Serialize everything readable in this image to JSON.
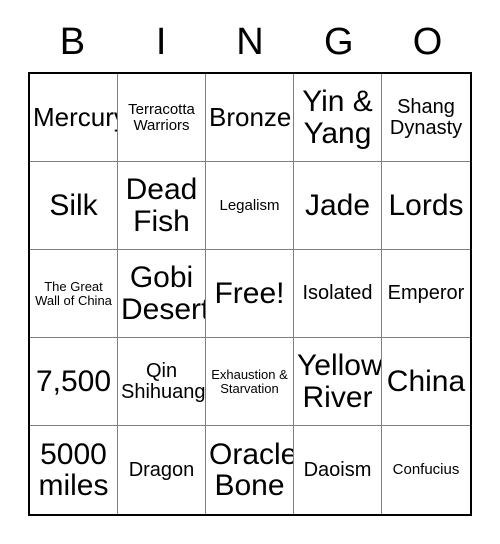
{
  "card": {
    "title_letters": [
      "B",
      "I",
      "N",
      "G",
      "O"
    ],
    "grid": {
      "rows": 5,
      "columns": 5,
      "outer_border_color": "#000000",
      "inner_border_color": "#808080",
      "background_color": "#ffffff",
      "text_color": "#000000"
    },
    "cells": [
      {
        "text": "Mercury",
        "size": "lg"
      },
      {
        "text": "Terracotta Warriors",
        "size": "sm"
      },
      {
        "text": "Bronze",
        "size": "lg"
      },
      {
        "text": "Yin & Yang",
        "size": "xl"
      },
      {
        "text": "Shang Dynasty",
        "size": "md"
      },
      {
        "text": "Silk",
        "size": "xl"
      },
      {
        "text": "Dead Fish",
        "size": "xl"
      },
      {
        "text": "Legalism",
        "size": "sm"
      },
      {
        "text": "Jade",
        "size": "xl"
      },
      {
        "text": "Lords",
        "size": "xl"
      },
      {
        "text": "The Great Wall of China",
        "size": "xs"
      },
      {
        "text": "Gobi Desert",
        "size": "xl"
      },
      {
        "text": "Free!",
        "size": "xl"
      },
      {
        "text": "Isolated",
        "size": "md"
      },
      {
        "text": "Emperor",
        "size": "md"
      },
      {
        "text": "7,500",
        "size": "xl"
      },
      {
        "text": "Qin Shihuang",
        "size": "md"
      },
      {
        "text": "Exhaustion & Starvation",
        "size": "xs"
      },
      {
        "text": "Yellow River",
        "size": "xl"
      },
      {
        "text": "China",
        "size": "xl"
      },
      {
        "text": "5000 miles",
        "size": "xl"
      },
      {
        "text": "Dragon",
        "size": "md"
      },
      {
        "text": "Oracle Bone",
        "size": "xl"
      },
      {
        "text": "Daoism",
        "size": "md"
      },
      {
        "text": "Confucius",
        "size": "sm"
      }
    ]
  }
}
